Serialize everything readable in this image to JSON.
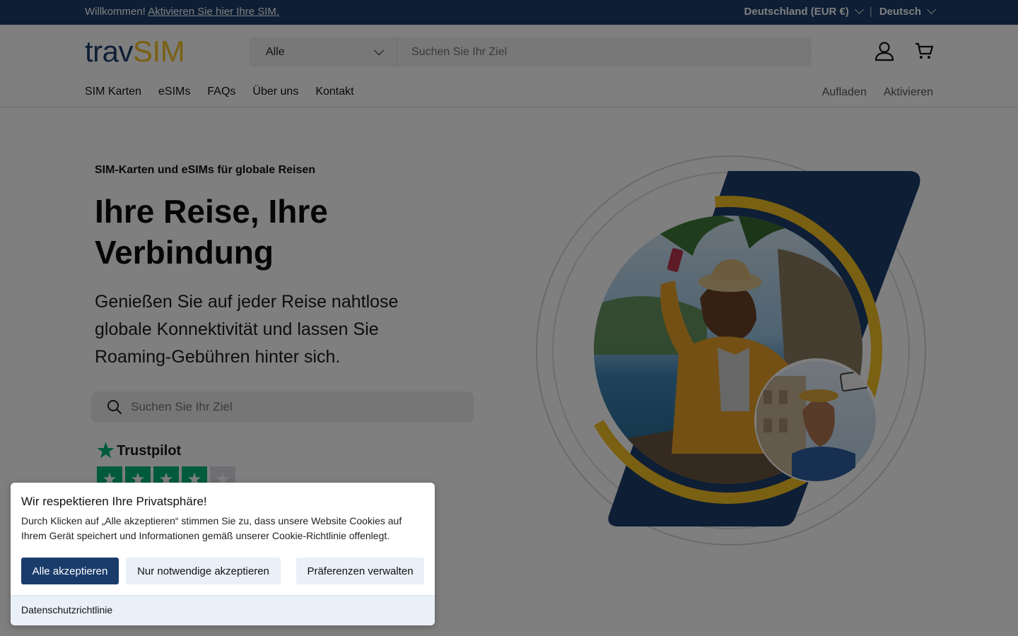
{
  "topbar": {
    "welcome": "Willkommen!",
    "activate_link": "Aktivieren Sie hier Ihre SIM.",
    "country": "Deutschland (EUR €)",
    "language": "Deutsch"
  },
  "header": {
    "logo_part1": "trav",
    "logo_part2": "SIM",
    "category": "Alle",
    "search_placeholder": "Suchen Sie Ihr Ziel",
    "account_icon": "user-icon",
    "cart_icon": "cart-icon"
  },
  "nav": {
    "left": [
      "SIM Karten",
      "eSIMs",
      "FAQs",
      "Über uns",
      "Kontakt"
    ],
    "right": [
      "Aufladen",
      "Aktivieren"
    ]
  },
  "hero": {
    "kicker": "SIM-Karten und eSIMs für globale Reisen",
    "title": "Ihre Reise, Ihre Verbindung",
    "lead": "Genießen Sie auf jeder Reise nahtlose globale Konnektivität und lassen Sie Roaming-Gebühren hinter sich.",
    "search_placeholder": "Suchen Sie Ihr Ziel",
    "trustpilot": "Trustpilot",
    "rating_stars": 4
  },
  "cookie": {
    "title": "Wir respektieren Ihre Privatsphäre!",
    "text": "Durch Klicken auf „Alle akzeptieren“ stimmen Sie zu, dass unsere Website Cookies auf Ihrem Gerät speichert und Informationen gemäß unserer Cookie-Richtlinie offenlegt.",
    "accept_all": "Alle akzeptieren",
    "necessary_only": "Nur notwendige akzeptieren",
    "manage": "Präferenzen verwalten",
    "policy": "Datenschutzrichtlinie"
  },
  "colors": {
    "brand_navy": "#1a3c6b",
    "brand_yellow": "#f5c024",
    "trustpilot_green": "#00b67a"
  }
}
